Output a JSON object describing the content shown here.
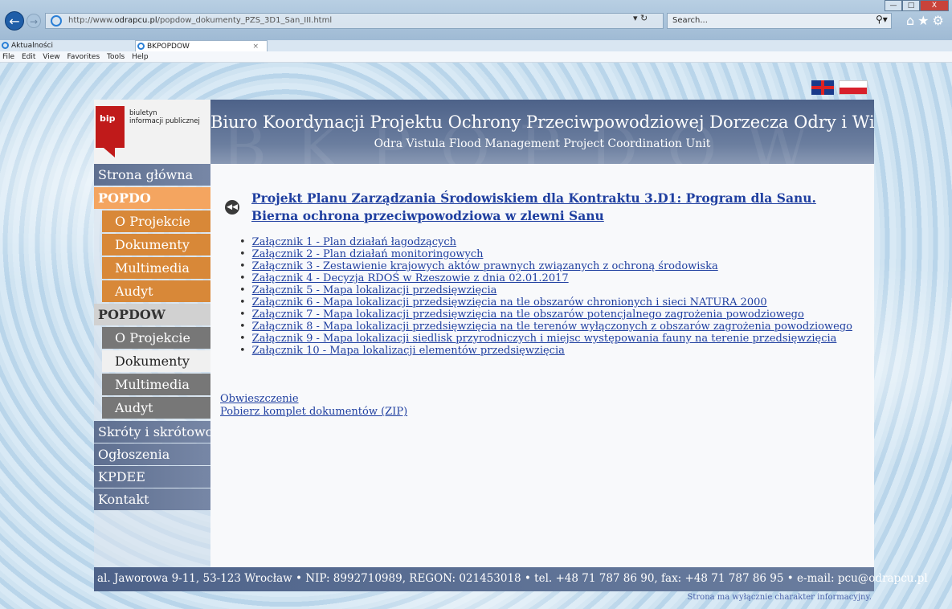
{
  "browser": {
    "address": "http://www.odrapcu.pl/popdow_dokumenty_PZS_3D1_San_III.html",
    "address_prefix": "http://www.",
    "address_domain": "odrapcu.pl",
    "address_path": "/popdow_dokumenty_PZS_3D1_San_III.html",
    "search_placeholder": "Search...",
    "tabs": [
      {
        "label": "Aktualności"
      },
      {
        "label": "BKPOPDOW",
        "close": "×"
      }
    ],
    "menu": [
      "File",
      "Edit",
      "View",
      "Favorites",
      "Tools",
      "Help"
    ],
    "win_min": "—",
    "win_max": "□",
    "win_close": "X",
    "addr_actions": "▾ ↻"
  },
  "logo": {
    "mark": "bip",
    "caption_line1": "biuletyn",
    "caption_line2": "informacji publicznej"
  },
  "header": {
    "watermark": "BKPOPDOW",
    "title": "Biuro Koordynacji Projektu Ochrony Przeciwpowodziowej Dorzecza Odry i Wisły",
    "subtitle": "Odra Vistula Flood Management Project Coordination Unit"
  },
  "sidebar": {
    "items": [
      {
        "label": "Strona główna"
      },
      {
        "label": "POPDO"
      },
      {
        "label": "O Projekcie"
      },
      {
        "label": "Dokumenty"
      },
      {
        "label": "Multimedia"
      },
      {
        "label": "Audyt"
      },
      {
        "label": "POPDOW"
      },
      {
        "label": "O Projekcie"
      },
      {
        "label": "Dokumenty"
      },
      {
        "label": "Multimedia"
      },
      {
        "label": "Audyt"
      },
      {
        "label": "Skróty i skrótowce"
      },
      {
        "label": "Ogłoszenia"
      },
      {
        "label": "KPDEE"
      },
      {
        "label": "Kontakt"
      }
    ]
  },
  "content": {
    "back_icon": "◀◀",
    "title": "Projekt Planu Zarządzania Środowiskiem dla Kontraktu 3.D1: Program dla Sanu. Bierna ochrona przeciwpowodziowa w zlewni Sanu",
    "attachments": [
      "Załącznik 1 - Plan działań łagodzących",
      "Załącznik 2 - Plan działań monitoringowych",
      "Załącznik 3 - Zestawienie krajowych aktów prawnych związanych z ochroną środowiska",
      "Załącznik 4 - Decyzja RDOŚ w Rzeszowie z dnia 02.01.2017",
      "Załącznik 5 - Mapa lokalizacji przedsięwzięcia",
      "Załącznik 6 - Mapa lokalizacji przedsięwzięcia na tle obszarów chronionych i sieci NATURA 2000",
      "Załącznik 7 - Mapa lokalizacji przedsięwzięcia na tle obszarów potencjalnego zagrożenia powodziowego",
      "Załącznik 8 - Mapa lokalizacji przedsięwzięcia na tle terenów wyłączonych z obszarów zagrożenia powodziowego",
      "Załącznik 9 - Mapa lokalizacji siedlisk przyrodniczych i miejsc występowania fauny na terenie przedsięwzięcia",
      "Załącznik 10 - Mapa lokalizacji elementów przedsięwzięcia"
    ],
    "notice_link": "Obwieszczenie",
    "zip_link": "Pobierz komplet dokumentów (ZIP)"
  },
  "footer": {
    "address": "al. Jaworowa 9-11, 53-123 Wrocław • NIP: 8992710989, REGON: 021453018 • tel. +48 71 787 86 90, fax: +48 71 787 86 95 • e-mail: pcu@odrapcu.pl",
    "note": "Strona ma wyłącznie charakter informacyjny."
  }
}
